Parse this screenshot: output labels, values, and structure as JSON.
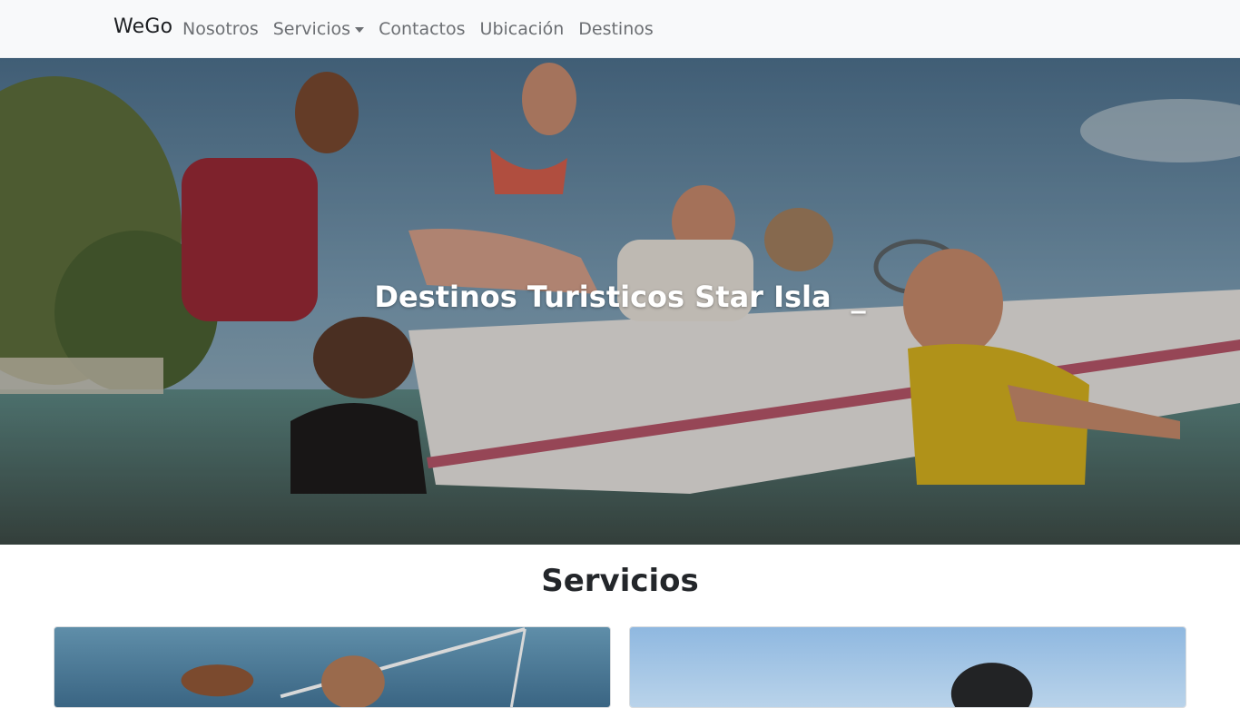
{
  "navbar": {
    "brand": "WeGo",
    "items": [
      {
        "label": "Nosotros",
        "has_dropdown": false
      },
      {
        "label": "Servicios",
        "has_dropdown": true
      },
      {
        "label": "Contactos",
        "has_dropdown": false
      },
      {
        "label": "Ubicación",
        "has_dropdown": false
      },
      {
        "label": "Destinos",
        "has_dropdown": false
      }
    ]
  },
  "hero": {
    "title": "Destinos Turisticos Star Isla",
    "cursor": "_"
  },
  "services": {
    "title": "Servicios"
  },
  "colors": {
    "navbar_bg": "#f8f9fa",
    "nav_link": "#6c6f73",
    "hero_text": "#ffffff"
  }
}
